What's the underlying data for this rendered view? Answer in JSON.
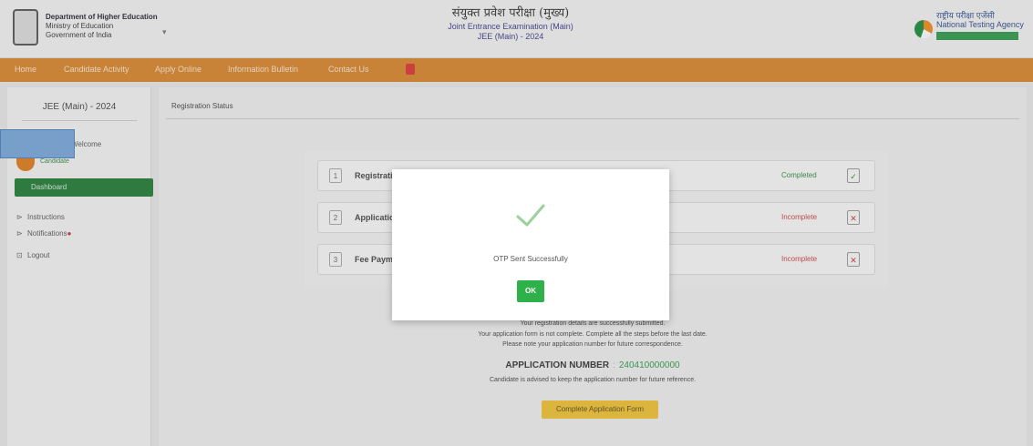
{
  "header": {
    "dept_line1": "Department of Higher Education",
    "dept_line2": "Ministry of Education",
    "dept_line3": "Government of India",
    "title_hindi": "संयुक्त प्रवेश परीक्षा (मुख्य)",
    "title_en": "Joint Entrance Examination (Main)",
    "title_exam": "JEE (Main) - 2024",
    "nta_hindi": "राष्ट्रीय परीक्षा एजेंसी",
    "nta_en": "National Testing Agency"
  },
  "navbar": {
    "items": [
      "Home",
      "Candidate Activity",
      "Apply Online",
      "Information Bulletin",
      "Contact Us"
    ]
  },
  "sidebar": {
    "title": "JEE (Main) - 2024",
    "user_name": "Welcome",
    "user_sub": "Candidate",
    "active_item": "Dashboard",
    "links": [
      "Instructions",
      "Notifications",
      "Logout"
    ]
  },
  "main": {
    "breadcrumb": "Registration Status",
    "steps": [
      {
        "num": "1",
        "label": "Registration Form",
        "status": "Completed",
        "mark": "✓",
        "state": "ok"
      },
      {
        "num": "2",
        "label": "Application Form",
        "status": "Incomplete",
        "mark": "✕",
        "state": "bad"
      },
      {
        "num": "3",
        "label": "Fee Payment",
        "status": "Incomplete",
        "mark": "✕",
        "state": "bad"
      }
    ],
    "info1": "Your registration details are successfully submitted.",
    "info2": "Your application form is not complete. Complete all the steps before the last date.",
    "info3": "Please note your application number for future correspondence.",
    "app_label": "APPLICATION NUMBER",
    "app_sep": ":",
    "app_value": "240410000000",
    "info4": "Candidate is advised to keep the application number for future reference.",
    "button": "Complete Application Form"
  },
  "modal": {
    "message": "OTP Sent Successfully",
    "ok_label": "OK"
  },
  "colors": {
    "navbar": "#d9862a",
    "sidebar_active": "#1f7a32",
    "status_ok": "#2e8a3a",
    "status_bad": "#d04040",
    "modal_ok": "#2eb04a",
    "action_button": "#f2c232"
  }
}
